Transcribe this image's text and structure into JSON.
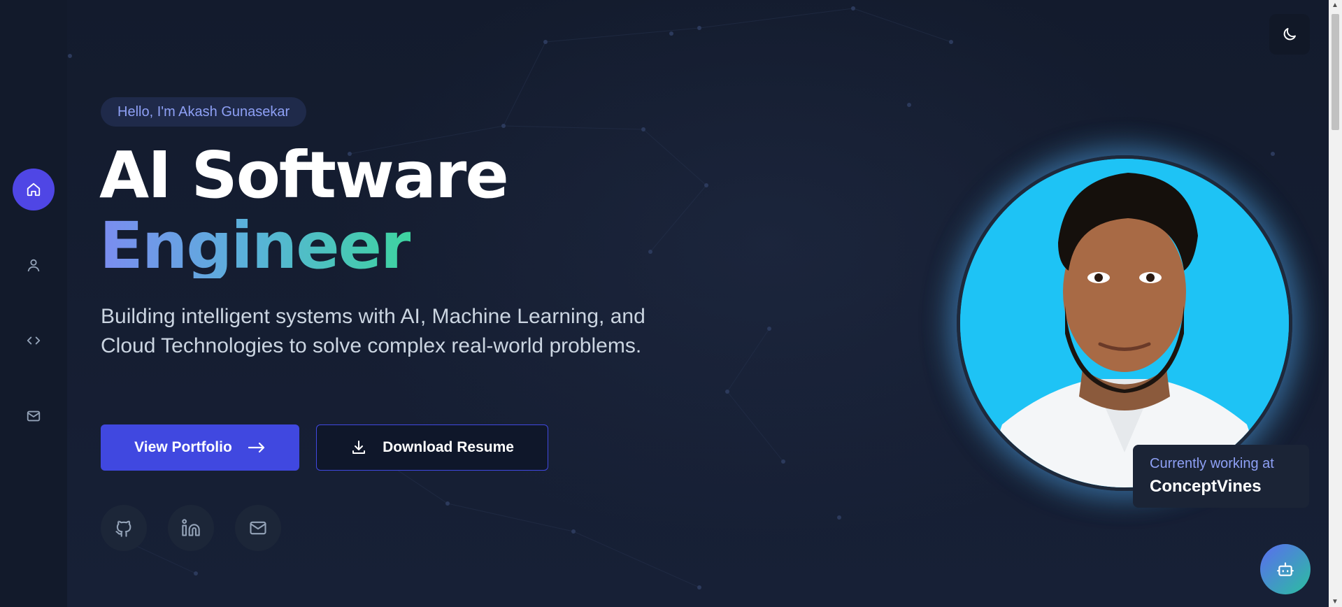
{
  "sidebar": {
    "items": [
      {
        "icon": "home-icon",
        "label": "Home",
        "active": true
      },
      {
        "icon": "user-icon",
        "label": "About",
        "active": false
      },
      {
        "icon": "code-icon",
        "label": "Projects",
        "active": false
      },
      {
        "icon": "mail-icon",
        "label": "Contact",
        "active": false
      }
    ]
  },
  "header": {
    "theme_toggle_icon": "moon-icon"
  },
  "hero": {
    "greeting": "Hello, I'm Akash Gunasekar",
    "title_line1": "AI Software",
    "title_line2": "Engineer",
    "description": "Building intelligent systems with AI, Machine Learning, and Cloud Technologies to solve complex real-world problems.",
    "primary_button": "View Portfolio",
    "secondary_button": "Download Resume",
    "socials": [
      {
        "icon": "github-icon"
      },
      {
        "icon": "linkedin-icon"
      },
      {
        "icon": "mail-icon"
      }
    ]
  },
  "profile": {
    "working_label": "Currently working at",
    "company": "ConceptVines"
  },
  "chatbot": {
    "icon": "bot-icon"
  },
  "colors": {
    "accent": "#4048e0",
    "background": "#151d2f",
    "gradient_start": "#7b8cf0",
    "gradient_end": "#3ed4a0",
    "photo_background": "#1ec3f5"
  }
}
